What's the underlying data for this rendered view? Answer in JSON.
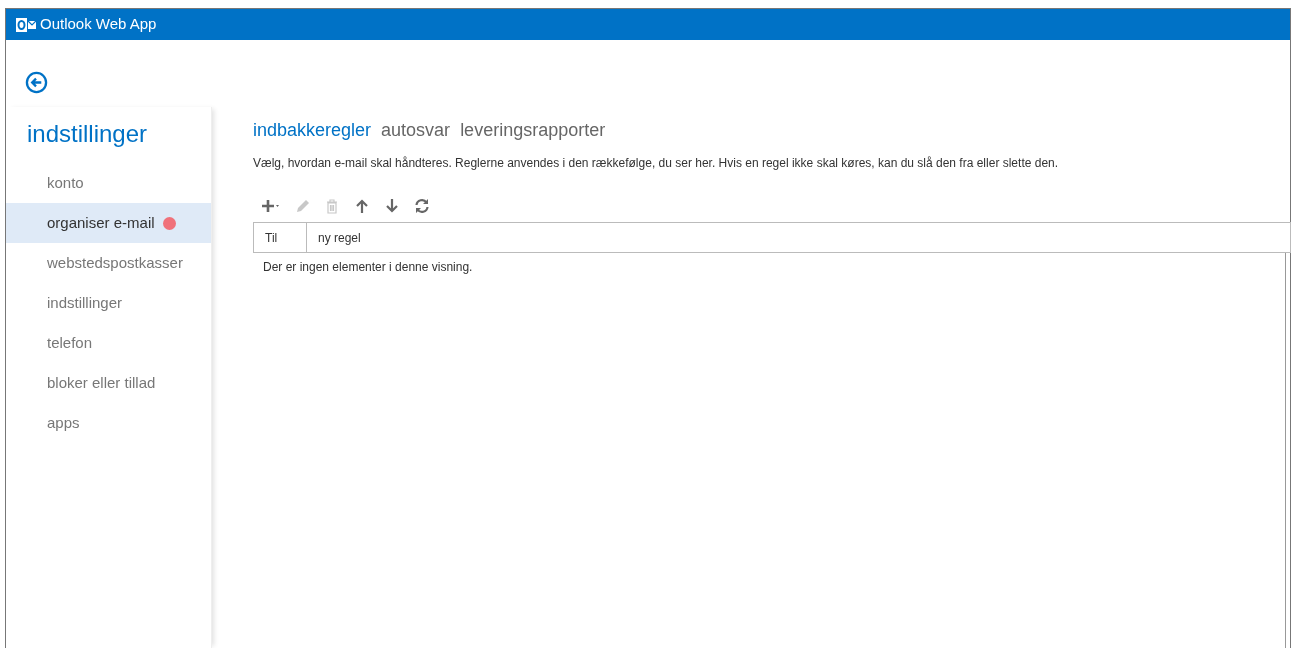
{
  "app": {
    "title": "Outlook Web App"
  },
  "sidebar": {
    "title": "indstillinger",
    "items": [
      {
        "label": "konto",
        "selected": false,
        "alert": false
      },
      {
        "label": "organiser e-mail",
        "selected": true,
        "alert": true
      },
      {
        "label": "webstedspostkasser",
        "selected": false,
        "alert": false
      },
      {
        "label": "indstillinger",
        "selected": false,
        "alert": false
      },
      {
        "label": "telefon",
        "selected": false,
        "alert": false
      },
      {
        "label": "bloker eller tillad",
        "selected": false,
        "alert": false
      },
      {
        "label": "apps",
        "selected": false,
        "alert": false
      }
    ]
  },
  "tabs": [
    {
      "label": "indbakkeregler",
      "selected": true
    },
    {
      "label": "autosvar",
      "selected": false
    },
    {
      "label": "leveringsrapporter",
      "selected": false
    }
  ],
  "description": "Vælg, hvordan e-mail skal håndteres. Reglerne anvendes i den rækkefølge, du ser her. Hvis en regel ikke skal køres, kan du slå den fra eller slette den.",
  "toolbar": [
    {
      "kind": "add",
      "disabled": false
    },
    {
      "kind": "edit",
      "disabled": true
    },
    {
      "kind": "delete",
      "disabled": true
    },
    {
      "kind": "up",
      "disabled": false
    },
    {
      "kind": "down",
      "disabled": false
    },
    {
      "kind": "refresh",
      "disabled": false
    }
  ],
  "table": {
    "columns": [
      "Til",
      "ny regel"
    ],
    "empty_message": "Der er ingen elementer i denne visning."
  }
}
